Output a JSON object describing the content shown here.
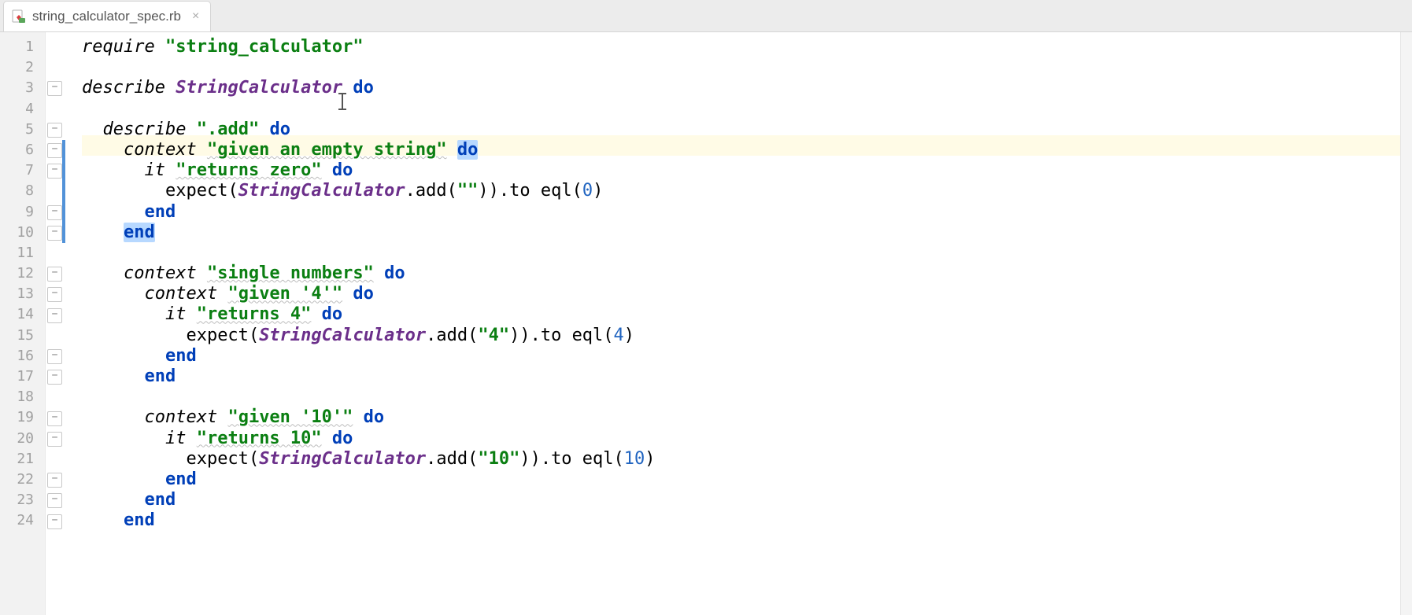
{
  "tab": {
    "filename": "string_calculator_spec.rb"
  },
  "editor": {
    "line_count": 24,
    "highlighted_line": 6,
    "change_bar": {
      "from": 6,
      "to": 10
    },
    "fold_marks_at": [
      3,
      5,
      6,
      7,
      9,
      10,
      12,
      13,
      14,
      16,
      17,
      19,
      20,
      22,
      23,
      24
    ],
    "caret": {
      "line": 3,
      "after_token_index": 2
    }
  },
  "code": [
    {
      "indent": 0,
      "tokens": [
        [
          "id",
          "require"
        ],
        [
          "sp",
          " "
        ],
        [
          "str",
          "\"string_calculator\""
        ]
      ]
    },
    {
      "indent": 0,
      "tokens": []
    },
    {
      "indent": 0,
      "tokens": [
        [
          "id",
          "describe"
        ],
        [
          "sp",
          " "
        ],
        [
          "cls",
          "StringCalculator"
        ],
        [
          "sp",
          " "
        ],
        [
          "kw",
          "do"
        ]
      ]
    },
    {
      "indent": 0,
      "tokens": []
    },
    {
      "indent": 1,
      "tokens": [
        [
          "id",
          "describe"
        ],
        [
          "sp",
          " "
        ],
        [
          "str",
          "\".add\""
        ],
        [
          "sp",
          " "
        ],
        [
          "kw",
          "do"
        ]
      ]
    },
    {
      "indent": 2,
      "tokens": [
        [
          "id",
          "context"
        ],
        [
          "sp",
          " "
        ],
        [
          "str",
          "\"given an empty string\"",
          "wavy"
        ],
        [
          "sp",
          " "
        ],
        [
          "kw",
          "do",
          "sel"
        ]
      ]
    },
    {
      "indent": 3,
      "tokens": [
        [
          "id",
          "it"
        ],
        [
          "sp",
          " "
        ],
        [
          "str",
          "\"returns zero\"",
          "wavy"
        ],
        [
          "sp",
          " "
        ],
        [
          "kw",
          "do"
        ]
      ]
    },
    {
      "indent": 4,
      "tokens": [
        [
          "fn",
          "expect"
        ],
        [
          "pn",
          "("
        ],
        [
          "cls",
          "StringCalculator"
        ],
        [
          "pn",
          ".add("
        ],
        [
          "str",
          "\"\""
        ],
        [
          "pn",
          ")).to eql("
        ],
        [
          "num",
          "0"
        ],
        [
          "pn",
          ")"
        ]
      ]
    },
    {
      "indent": 3,
      "tokens": [
        [
          "kw",
          "end"
        ]
      ]
    },
    {
      "indent": 2,
      "tokens": [
        [
          "kw",
          "end",
          "sel"
        ]
      ]
    },
    {
      "indent": 0,
      "tokens": []
    },
    {
      "indent": 2,
      "tokens": [
        [
          "id",
          "context"
        ],
        [
          "sp",
          " "
        ],
        [
          "str",
          "\"single numbers\"",
          "wavy"
        ],
        [
          "sp",
          " "
        ],
        [
          "kw",
          "do"
        ]
      ]
    },
    {
      "indent": 3,
      "tokens": [
        [
          "id",
          "context"
        ],
        [
          "sp",
          " "
        ],
        [
          "str",
          "\"given '4'\"",
          "wavy"
        ],
        [
          "sp",
          " "
        ],
        [
          "kw",
          "do"
        ]
      ]
    },
    {
      "indent": 4,
      "tokens": [
        [
          "id",
          "it"
        ],
        [
          "sp",
          " "
        ],
        [
          "str",
          "\"returns 4\"",
          "wavy"
        ],
        [
          "sp",
          " "
        ],
        [
          "kw",
          "do"
        ]
      ]
    },
    {
      "indent": 5,
      "tokens": [
        [
          "fn",
          "expect"
        ],
        [
          "pn",
          "("
        ],
        [
          "cls",
          "StringCalculator"
        ],
        [
          "pn",
          ".add("
        ],
        [
          "str",
          "\"4\""
        ],
        [
          "pn",
          ")).to eql("
        ],
        [
          "num",
          "4"
        ],
        [
          "pn",
          ")"
        ]
      ]
    },
    {
      "indent": 4,
      "tokens": [
        [
          "kw",
          "end"
        ]
      ]
    },
    {
      "indent": 3,
      "tokens": [
        [
          "kw",
          "end"
        ]
      ]
    },
    {
      "indent": 0,
      "tokens": []
    },
    {
      "indent": 3,
      "tokens": [
        [
          "id",
          "context"
        ],
        [
          "sp",
          " "
        ],
        [
          "str",
          "\"given '10'\"",
          "wavy"
        ],
        [
          "sp",
          " "
        ],
        [
          "kw",
          "do"
        ]
      ]
    },
    {
      "indent": 4,
      "tokens": [
        [
          "id",
          "it"
        ],
        [
          "sp",
          " "
        ],
        [
          "str",
          "\"returns 10\"",
          "wavy"
        ],
        [
          "sp",
          " "
        ],
        [
          "kw",
          "do"
        ]
      ]
    },
    {
      "indent": 5,
      "tokens": [
        [
          "fn",
          "expect"
        ],
        [
          "pn",
          "("
        ],
        [
          "cls",
          "StringCalculator"
        ],
        [
          "pn",
          ".add("
        ],
        [
          "str",
          "\"10\""
        ],
        [
          "pn",
          ")).to eql("
        ],
        [
          "num",
          "10"
        ],
        [
          "pn",
          ")"
        ]
      ]
    },
    {
      "indent": 4,
      "tokens": [
        [
          "kw",
          "end"
        ]
      ]
    },
    {
      "indent": 3,
      "tokens": [
        [
          "kw",
          "end"
        ]
      ]
    },
    {
      "indent": 2,
      "tokens": [
        [
          "kw",
          "end"
        ]
      ]
    }
  ]
}
